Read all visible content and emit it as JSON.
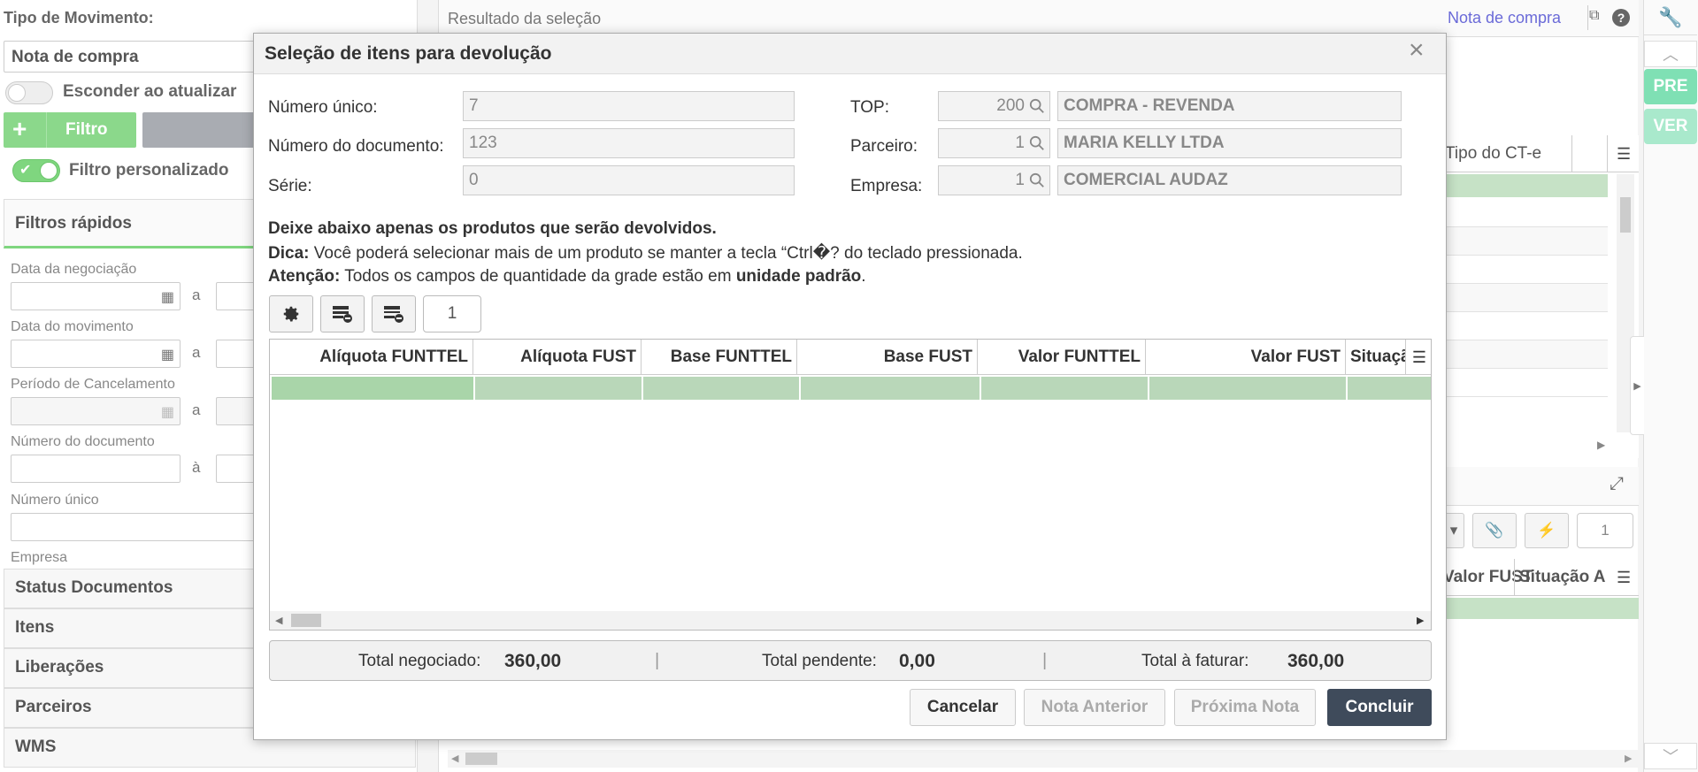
{
  "left_panel": {
    "tipo_label": "Tipo de Movimento:",
    "tipo_value": "Nota de compra",
    "esconder_label": "Esconder ao atualizar",
    "filtro_button": "Filtro",
    "filtro_personalizado_label": "Filtro personalizado",
    "filtros_rapidos": "Filtros rápidos",
    "data_negociacao": "Data da negociação",
    "data_movimento": "Data do movimento",
    "periodo_cancelamento": "Período de Cancelamento",
    "numero_documento": "Número do documento",
    "numero_unico": "Número único",
    "empresa": "Empresa",
    "range_a": "a",
    "range_a2": "à",
    "sections": [
      "Status Documentos",
      "Itens",
      "Liberações",
      "Parceiros",
      "WMS"
    ]
  },
  "result_panel": {
    "title": "Resultado da seleção",
    "link": "Nota de compra",
    "col_tipo_cte": "Tipo do CT-e",
    "col_valor_fust": "Valor FUST",
    "col_situacao": "Situação A",
    "page_number": "1"
  },
  "rail": {
    "pre": "PRE",
    "ver": "VER"
  },
  "modal": {
    "title": "Seleção de itens para devolução",
    "fields": {
      "numero_unico_label": "Número único:",
      "numero_unico_value": "7",
      "numero_documento_label": "Número do documento:",
      "numero_documento_value": "123",
      "serie_label": "Série:",
      "serie_value": "0",
      "top_label": "TOP:",
      "top_code": "200",
      "top_desc": "COMPRA - REVENDA",
      "parceiro_label": "Parceiro:",
      "parceiro_code": "1",
      "parceiro_desc": "MARIA KELLY LTDA",
      "empresa_label": "Empresa:",
      "empresa_code": "1",
      "empresa_desc": "COMERCIAL AUDAZ"
    },
    "instructions": {
      "line1": "Deixe abaixo apenas os produtos que serão devolvidos.",
      "dica_label": "Dica:",
      "dica_text": " Você poderá selecionar mais de um produto se manter a tecla “Ctrl�? do teclado pressionada.",
      "atencao_label": "Atenção:",
      "atencao_text": " Todos os campos de quantidade da grade estão em ",
      "atencao_bold": "unidade padrão",
      "atencao_end": "."
    },
    "page_number": "1",
    "grid_columns": [
      "Alíquota FUNTTEL",
      "Alíquota FUST",
      "Base FUNTTEL",
      "Base FUST",
      "Valor FUNTTEL",
      "Valor FUST",
      "Situaçã"
    ],
    "totals": {
      "negociado_label": "Total negociado:",
      "negociado_value": "360,00",
      "pendente_label": "Total pendente:",
      "pendente_value": "0,00",
      "faturar_label": "Total à faturar:",
      "faturar_value": "360,00",
      "separator": "|"
    },
    "buttons": {
      "cancelar": "Cancelar",
      "anterior": "Nota Anterior",
      "proxima": "Próxima Nota",
      "concluir": "Concluir"
    }
  },
  "colors": {
    "accent_green": "#7fd67f",
    "row_green": "#b9d7b9",
    "primary_button": "#3f4b5b",
    "link_blue": "#6a6ad8"
  }
}
